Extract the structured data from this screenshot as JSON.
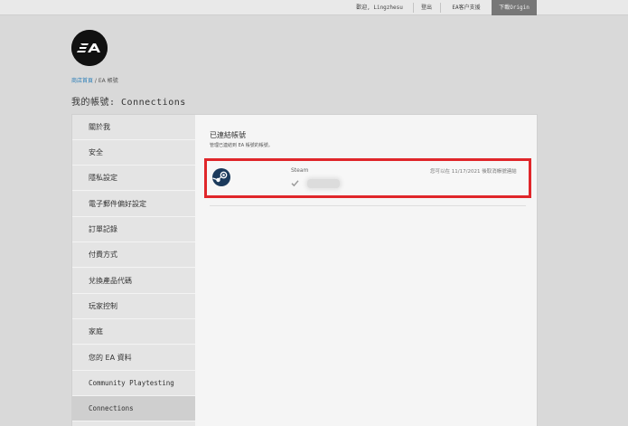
{
  "topbar": {
    "welcome": "歡迎, Lingzhesu",
    "logout": "登出",
    "support": "EA客户支援",
    "download": "下載Origin"
  },
  "logo": {
    "text": "EA"
  },
  "breadcrumb": {
    "home": "商店首頁",
    "separator": " / ",
    "current": "EA 帳號"
  },
  "page_title": "我的帳號: Connections",
  "sidebar": {
    "items": [
      {
        "label": "關於我"
      },
      {
        "label": "安全"
      },
      {
        "label": "隱私設定"
      },
      {
        "label": "電子郵件偏好設定"
      },
      {
        "label": "訂單記錄"
      },
      {
        "label": "付費方式"
      },
      {
        "label": "兌換產品代碼"
      },
      {
        "label": "玩家控制"
      },
      {
        "label": "家庭"
      },
      {
        "label": "您的 EA 資料"
      },
      {
        "label": "Community Playtesting"
      },
      {
        "label": "Connections"
      }
    ],
    "active_index": 11
  },
  "content": {
    "title": "已連結帳號",
    "subtitle": "管理已連結到 EA 帳號的帳號。",
    "connection": {
      "service": "Steam",
      "status": "您可以在 11/17/2021 後取消帳號連結",
      "icon": "steam-icon",
      "verified_icon": "check-icon"
    }
  },
  "colors": {
    "highlight_border": "#e0262a",
    "link": "#2d7fb8",
    "download_bg": "#777777"
  }
}
